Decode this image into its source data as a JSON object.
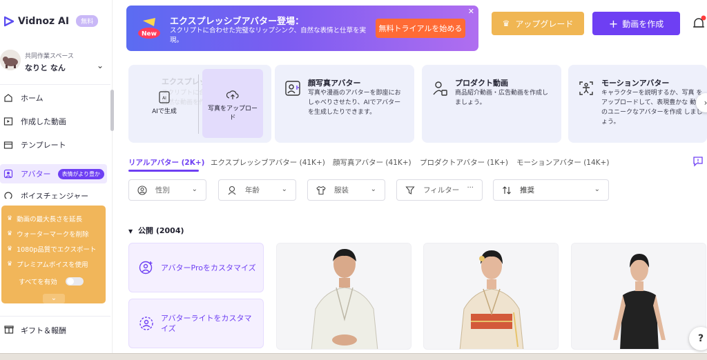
{
  "brand": {
    "name": "Vidnoz AI",
    "badge": "無料"
  },
  "workspace": {
    "label": "共同作業スペース",
    "name": "なりと なん"
  },
  "sidebar": {
    "items": [
      {
        "label": "ホーム"
      },
      {
        "label": "作成した動画"
      },
      {
        "label": "テンプレート"
      },
      {
        "label": "アバター",
        "badge": "表情がより豊か"
      },
      {
        "label": "ボイスチェンジャー"
      }
    ],
    "promo": {
      "items": [
        "動画の最大長さを延長",
        "ウォーターマークを削除",
        "1080p品質でエクスポート",
        "プレミアムボイスを使用"
      ],
      "toggle_label": "すべてを有効"
    },
    "gift": "ギフト＆報酬"
  },
  "banner": {
    "title": "エクスプレッシブアバター登場：",
    "description": "スクリプトに合わせた完璧なリップシンク、自然な表情と仕草を実現。",
    "cta": "無料トライアルを始める",
    "new_badge": "New"
  },
  "header": {
    "upgrade": "アップグレード",
    "create": "動画を作成"
  },
  "cards": [
    {
      "title": "エクスプレッシブアバター",
      "description": "スクリプトに合わせた表情・仕草で自然な動画を作成",
      "sub_ai": "AIで生成",
      "sub_upload": "写真をアップロード"
    },
    {
      "title": "顔写真アバター",
      "description": "写真や漫画のアバターを即座にお しゃべりさせたり、AIでアバター を生成したりできます。"
    },
    {
      "title": "プロダクト動画",
      "description": "商品紹介動画・広告動画を作成し ましょう。"
    },
    {
      "title": "モーションアバター",
      "description": "キャラクターを説明するか、写真 をアップロードして、表現豊かな 動きのユニークなアバターを作成 しましょう。"
    }
  ],
  "tabs": [
    "リアルアバター (2K+)",
    "エクスプレッシブアバター (41K+)",
    "顔写真アバター (41K+)",
    "プロダクトアバター (1K+)",
    "モーションアバター (14K+)"
  ],
  "filters": {
    "gender": "性別",
    "age": "年齢",
    "outfit": "服装",
    "filter": "フィルター",
    "filter_more": "···",
    "sort": "推奨"
  },
  "section": {
    "title": "公開 (2004)"
  },
  "customize": {
    "pro": "アバターProをカスタマイズ",
    "lite": "アバターライトをカスタマイズ"
  },
  "colors": {
    "accent": "#6e3ff3",
    "upgrade": "#f0b653",
    "cta": "#ff6b35"
  },
  "help": "?"
}
